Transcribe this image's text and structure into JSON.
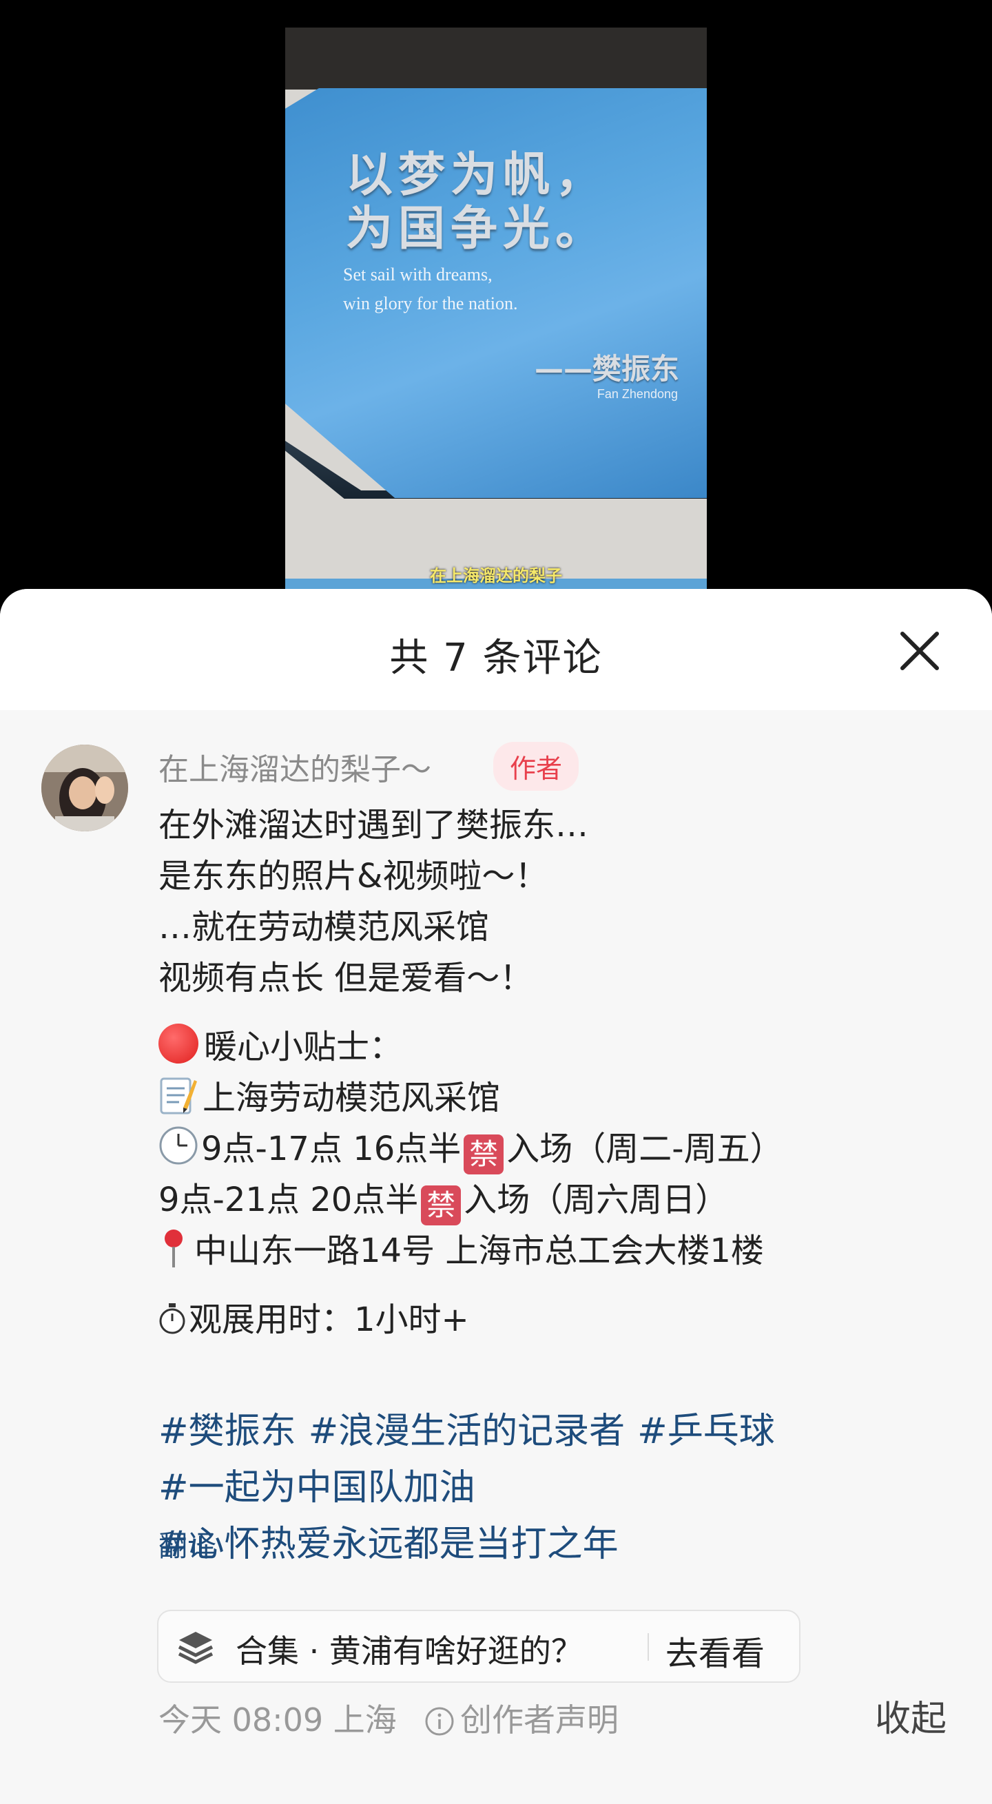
{
  "video": {
    "quote_cn_line1": "以梦为帆，",
    "quote_cn_line2": "为国争光。",
    "quote_en_line1": "Set sail with dreams,",
    "quote_en_line2": "win glory for the nation.",
    "quote_author": "——樊振东",
    "quote_author_en": "Fan Zhendong",
    "watermark": "在上海溜达的梨子"
  },
  "sheet": {
    "title": "共 7 条评论",
    "close_icon": "close-icon"
  },
  "comment": {
    "username": "在上海溜达的梨子～",
    "badge": "作者",
    "lines": {
      "l1": "在外滩溜达时遇到了樊振东…",
      "l2": "是东东的照片&视频啦～！",
      "l3": "…就在劳动模范风采馆",
      "l4": "视频有点长 但是爱看～！",
      "tip_title": "暖心小贴士：",
      "venue": "上海劳动模范风采馆",
      "hours1_a": "9点-17点 16点半",
      "hours1_b": "入场（周二-周五）",
      "hours2_a": "9点-21点 20点半",
      "hours2_b": "入场（周六周日）",
      "forbid_glyph": "禁",
      "address": "中山东一路14号 上海市总工会大楼1楼",
      "duration": "观展用时：1小时+"
    },
    "hashtags": [
      "#樊振东",
      "#浪漫生活的记录者",
      "#乒乓球",
      "#一起为中国队加油",
      "#心怀热爱永远都是当打之年"
    ],
    "translate": "翻译",
    "collection": {
      "label": "合集 · 黄浦有啥好逛的？",
      "action": "去看看"
    },
    "meta": {
      "time": "今天 08:09 上海",
      "declare": "创作者声明",
      "collapse": "收起"
    }
  }
}
